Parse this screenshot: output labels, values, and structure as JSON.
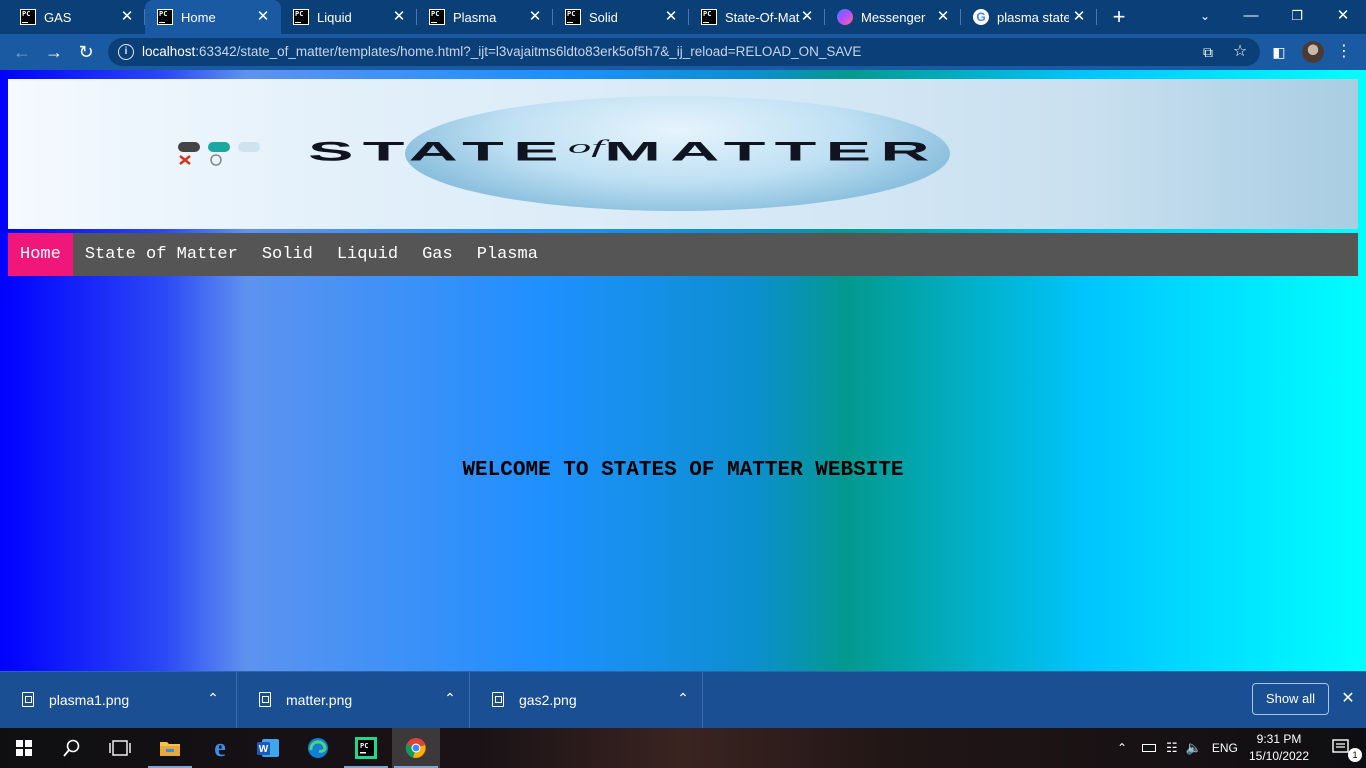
{
  "browser": {
    "tabs": [
      {
        "title": "GAS",
        "icon": "pycharm-icon",
        "active": false
      },
      {
        "title": "Home",
        "icon": "pycharm-icon",
        "active": true
      },
      {
        "title": "Liquid",
        "icon": "pycharm-icon",
        "active": false
      },
      {
        "title": "Plasma",
        "icon": "pycharm-icon",
        "active": false
      },
      {
        "title": "Solid",
        "icon": "pycharm-icon",
        "active": false
      },
      {
        "title": "State-Of-Mat",
        "icon": "pycharm-icon",
        "active": false
      },
      {
        "title": "Messenger",
        "icon": "messenger-icon",
        "active": false
      },
      {
        "title": "plasma state",
        "icon": "google-icon",
        "active": false
      }
    ],
    "url_host": "localhost",
    "url_rest": ":63342/state_of_matter/templates/home.html?_ijt=l3vajaitms6ldto83erk5of5h7&_ij_reload=RELOAD_ON_SAVE"
  },
  "page": {
    "banner": {
      "logo_main": "STATE",
      "logo_of": "of",
      "logo_end": "MATTER"
    },
    "nav": [
      {
        "label": "Home",
        "active": true
      },
      {
        "label": "State of Matter",
        "active": false
      },
      {
        "label": "Solid",
        "active": false
      },
      {
        "label": "Liquid",
        "active": false
      },
      {
        "label": "Gas",
        "active": false
      },
      {
        "label": "Plasma",
        "active": false
      }
    ],
    "welcome": "WELCOME TO STATES OF MATTER WEBSITE",
    "colors": {
      "nav_active": "#f0167a",
      "nav_bg": "#555555"
    }
  },
  "downloads": {
    "items": [
      "plasma1.png",
      "matter.png",
      "gas2.png"
    ],
    "show_all": "Show all"
  },
  "taskbar": {
    "apps": [
      "windows-start-icon",
      "search-icon",
      "task-view-icon",
      "file-explorer-icon",
      "edge-legacy-icon",
      "word-icon",
      "edge-icon",
      "pycharm-icon",
      "chrome-icon"
    ],
    "language": "ENG",
    "time": "9:31 PM",
    "date": "15/10/2022",
    "notification_count": "1"
  }
}
